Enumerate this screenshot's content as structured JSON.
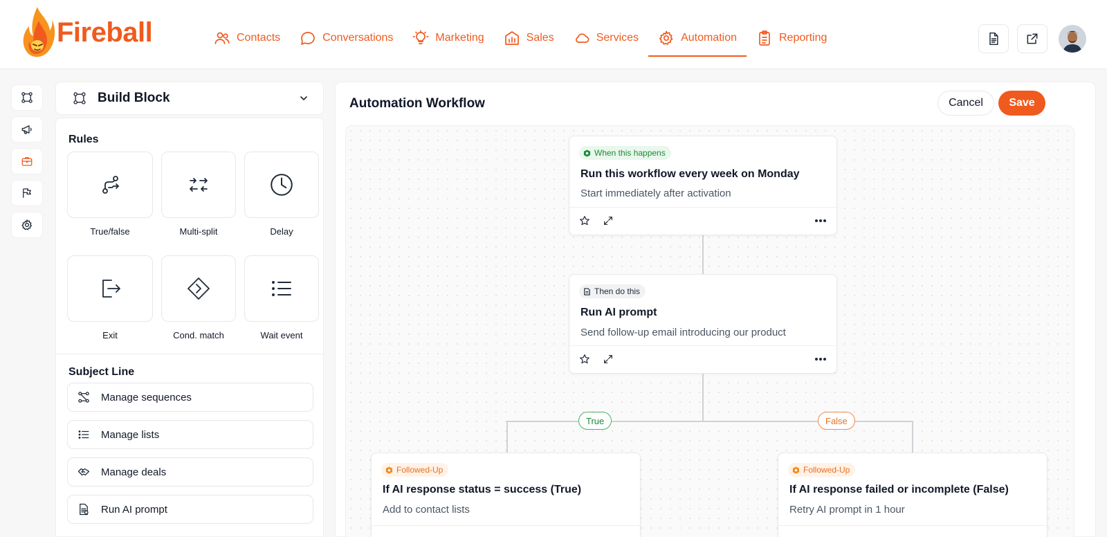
{
  "brand": {
    "name": "Fireball",
    "accent": "#f05a1e"
  },
  "nav": {
    "items": [
      {
        "label": "Contacts",
        "icon": "users-icon"
      },
      {
        "label": "Conversations",
        "icon": "chat-icon"
      },
      {
        "label": "Marketing",
        "icon": "lightbulb-icon"
      },
      {
        "label": "Sales",
        "icon": "store-chart-icon"
      },
      {
        "label": "Services",
        "icon": "cloud-icon"
      },
      {
        "label": "Automation",
        "icon": "gear-icon",
        "active": true
      },
      {
        "label": "Reporting",
        "icon": "clipboard-icon"
      }
    ]
  },
  "sidebar": {
    "title": "Build Block",
    "rules_title": "Rules",
    "rules": [
      {
        "label": "True/false",
        "icon": "branch-icon"
      },
      {
        "label": "Multi-split",
        "icon": "split-arrows-icon"
      },
      {
        "label": "Delay",
        "icon": "clock-icon"
      },
      {
        "label": "Exit",
        "icon": "exit-icon"
      },
      {
        "label": "Cond. match",
        "icon": "diamond-icon"
      },
      {
        "label": "Wait event",
        "icon": "list-icon"
      }
    ],
    "subject_title": "Subject Line",
    "subject_items": [
      {
        "label": "Manage sequences",
        "icon": "nodes-icon"
      },
      {
        "label": "Manage lists",
        "icon": "list-icon"
      },
      {
        "label": "Manage deals",
        "icon": "handshake-icon"
      },
      {
        "label": "Run AI prompt",
        "icon": "document-icon"
      }
    ]
  },
  "workflow": {
    "title": "Automation Workflow",
    "cancel_label": "Cancel",
    "save_label": "Save",
    "trigger": {
      "tag": "When this happens",
      "title": "Run this workflow every week on Monday",
      "subtitle": "Start immediately after activation"
    },
    "action": {
      "tag": "Then do this",
      "title": "Run AI prompt",
      "subtitle": "Send follow-up email introducing our product"
    },
    "branch_true_label": "True",
    "branch_false_label": "False",
    "true_node": {
      "tag": "Followed-Up",
      "title": "If AI response status = success (True)",
      "subtitle": "Add to contact lists"
    },
    "false_node": {
      "tag": "Followed-Up",
      "title": "If AI response failed or incomplete (False)",
      "subtitle": "Retry AI prompt in 1 hour"
    }
  }
}
